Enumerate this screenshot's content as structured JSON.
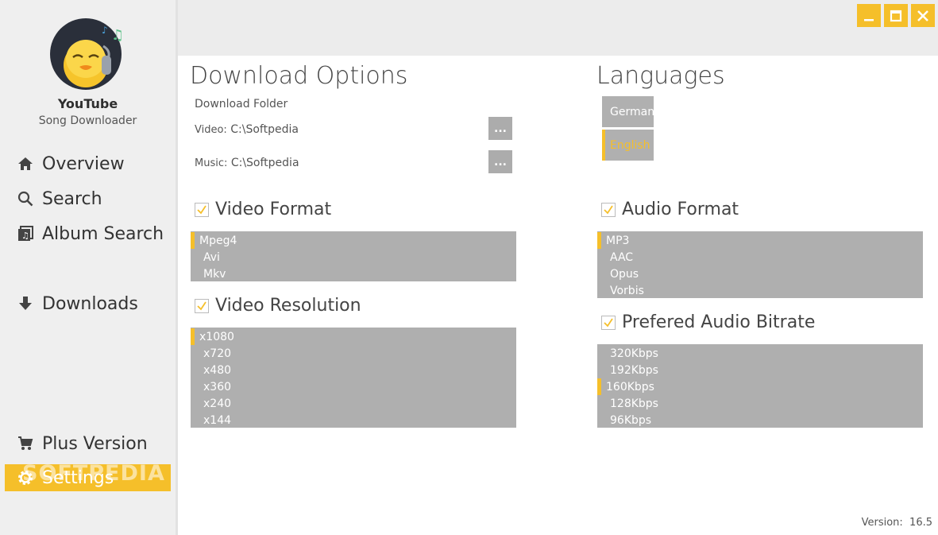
{
  "app": {
    "name": "YouTube",
    "subtitle": "Song Downloader",
    "watermark": "SOFTPEDIA",
    "version_label": "Version:",
    "version": "16.5"
  },
  "sidebar": {
    "items": [
      {
        "label": "Overview",
        "icon": "home-icon"
      },
      {
        "label": "Search",
        "icon": "search-icon"
      },
      {
        "label": "Album Search",
        "icon": "album-icon"
      },
      {
        "label": "Downloads",
        "icon": "download-arrow-icon"
      },
      {
        "label": "Plus Version",
        "icon": "cart-icon"
      },
      {
        "label": "Settings",
        "icon": "gear-icon",
        "active": true
      }
    ]
  },
  "window": {
    "buttons": [
      "minimize-icon",
      "maximize-icon",
      "close-icon"
    ]
  },
  "download_options": {
    "title": "Download Options",
    "folder_label": "Download Folder",
    "video_label": "Video:",
    "video_path": "C:\\Softpedia",
    "music_label": "Music:",
    "music_path": "C:\\Softpedia",
    "browse_label": "..."
  },
  "languages": {
    "title": "Languages",
    "items": [
      "German",
      "English"
    ],
    "selected": "English"
  },
  "video_format": {
    "title": "Video Format",
    "checked": true,
    "items": [
      "Mpeg4",
      "Avi",
      "Mkv"
    ],
    "selected": "Mpeg4"
  },
  "video_resolution": {
    "title": "Video Resolution",
    "checked": true,
    "items": [
      "x1080",
      "x720",
      "x480",
      "x360",
      "x240",
      "x144"
    ],
    "selected": "x1080"
  },
  "audio_format": {
    "title": "Audio Format",
    "checked": true,
    "items": [
      "MP3",
      "AAC",
      "Opus",
      "Vorbis"
    ],
    "selected": "MP3"
  },
  "audio_bitrate": {
    "title": "Prefered Audio Bitrate",
    "checked": true,
    "items": [
      "320Kbps",
      "192Kbps",
      "160Kbps",
      "128Kbps",
      "96Kbps"
    ],
    "selected": "160Kbps"
  },
  "colors": {
    "accent": "#f5bf2a",
    "list_bg": "#afafaf",
    "sidebar_bg": "#efefef"
  }
}
